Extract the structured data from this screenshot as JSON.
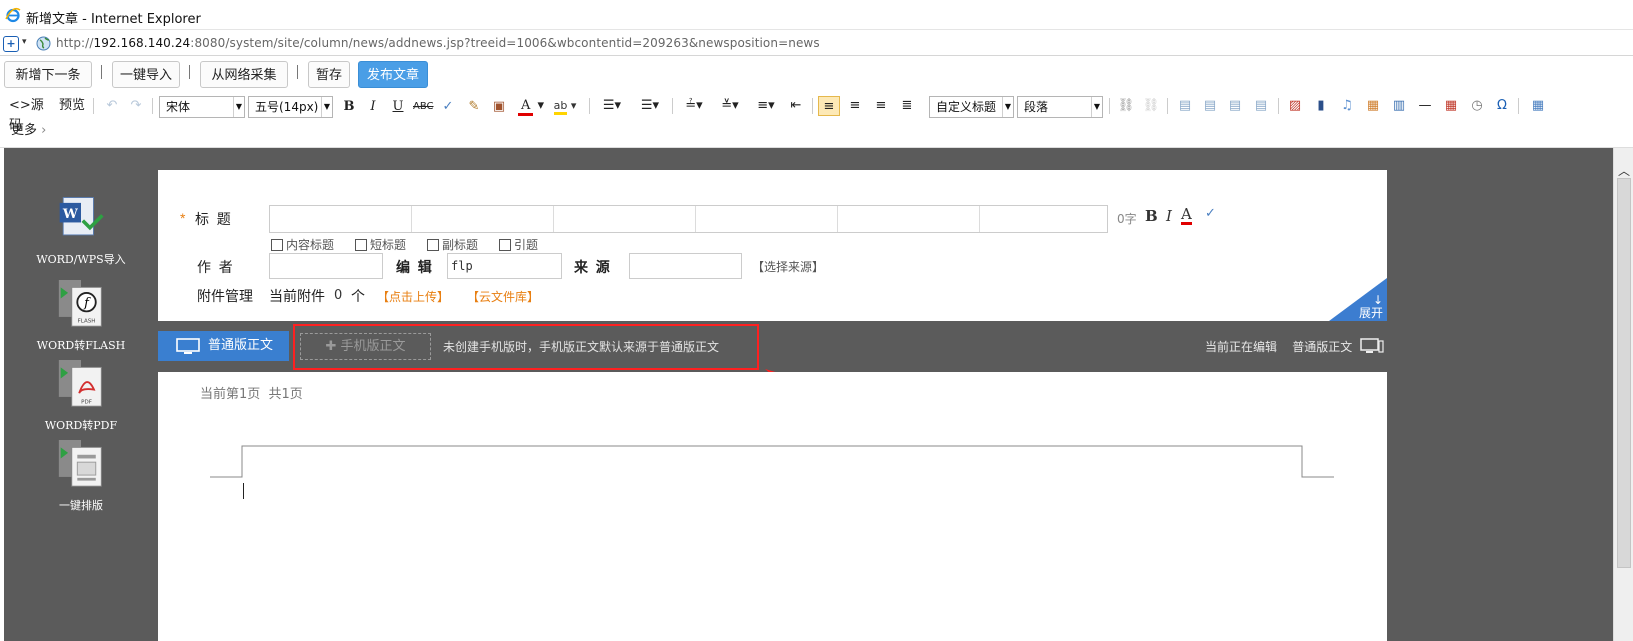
{
  "window": {
    "title": "新增文章 - Internet Explorer"
  },
  "address": {
    "url_scheme": "http://",
    "url_host": "192.168.140.24",
    "url_rest": ":8080/system/site/column/news/addnews.jsp?treeid=1006&wbcontentid=209263&newsposition=news"
  },
  "actions": {
    "new_next": "新增下一条",
    "one_click_import": "一键导入",
    "web_collect": "从网络采集",
    "save_draft": "暂存",
    "publish": "发布文章"
  },
  "toolbar": {
    "source": "<>源码",
    "preview": "预览",
    "font_family": "宋体",
    "font_size": "五号(14px)",
    "custom_heading": "自定义标题",
    "paragraph": "段落",
    "more": "更多"
  },
  "left_tools": [
    {
      "label": "WORD/WPS导入",
      "icon": "word-import-icon"
    },
    {
      "label": "WORD转FLASH",
      "icon": "word-to-flash-icon"
    },
    {
      "label": "WORD转PDF",
      "icon": "word-to-pdf-icon"
    },
    {
      "label": "一键排版",
      "icon": "auto-format-icon"
    }
  ],
  "form": {
    "required_mark": "*",
    "title_label": "标  题",
    "char_count": "0字",
    "options": [
      "内容标题",
      "短标题",
      "副标题",
      "引题"
    ],
    "author_label": "作  者",
    "author_value": "",
    "editor_label": "编  辑",
    "editor_value": "flp",
    "source_label": "来  源",
    "source_value": "",
    "select_source": "【选择来源】",
    "attachment_label": "附件管理",
    "current_attachments": "当前附件",
    "attachment_count": "0",
    "attachment_unit": "个",
    "upload_link": "【点击上传】",
    "cloud_link": "【云文件库】",
    "expand": "展开"
  },
  "tabs": {
    "normal": "普通版正文",
    "mobile": "手机版正文",
    "mobile_note": "未创建手机版时，手机版正文默认来源于普通版正文",
    "editing_status": "当前正在编辑",
    "editing_target": "普通版正文"
  },
  "doc": {
    "page_info": "当前第1页  共1页"
  },
  "colors": {
    "accent": "#3a7fd0",
    "publish": "#4a9ee6",
    "highlight": "#ff2020",
    "link_orange": "#e87f12",
    "workspace": "#5b5b5b"
  }
}
